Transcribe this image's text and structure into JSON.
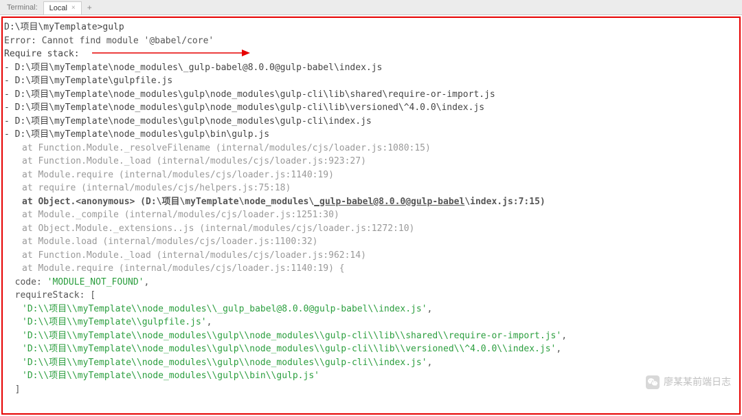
{
  "tabBar": {
    "titleLabel": "Terminal:",
    "tabs": [
      {
        "name": "Local",
        "active": true
      }
    ],
    "addLabel": "+"
  },
  "terminal": {
    "cmdLine": "D:\\项目\\myTemplate>gulp",
    "errorLine": "Error: Cannot find module '@babel/core'",
    "requireLabel": "Require stack:",
    "stackPaths": [
      "- D:\\项目\\myTemplate\\node_modules\\_gulp-babel@8.0.0@gulp-babel\\index.js",
      "- D:\\项目\\myTemplate\\gulpfile.js",
      "- D:\\项目\\myTemplate\\node_modules\\gulp\\node_modules\\gulp-cli\\lib\\shared\\require-or-import.js",
      "- D:\\项目\\myTemplate\\node_modules\\gulp\\node_modules\\gulp-cli\\lib\\versioned\\^4.0.0\\index.js",
      "- D:\\项目\\myTemplate\\node_modules\\gulp\\node_modules\\gulp-cli\\index.js",
      "- D:\\项目\\myTemplate\\node_modules\\gulp\\bin\\gulp.js"
    ],
    "atLines": [
      "at Function.Module._resolveFilename (internal/modules/cjs/loader.js:1080:15)",
      "at Function.Module._load (internal/modules/cjs/loader.js:923:27)",
      "at Module.require (internal/modules/cjs/loader.js:1140:19)",
      "at require (internal/modules/cjs/helpers.js:75:18)"
    ],
    "boldAt": {
      "prefix": "at Object.<anonymous> (D:\\项目\\myTemplate\\node_modules\\",
      "underlined": "_gulp-babel@8.0.0@gulp-babel",
      "suffix": "\\index.js:7:15)"
    },
    "atLines2": [
      "at Module._compile (internal/modules/cjs/loader.js:1251:30)",
      "at Object.Module._extensions..js (internal/modules/cjs/loader.js:1272:10)",
      "at Module.load (internal/modules/cjs/loader.js:1100:32)",
      "at Function.Module._load (internal/modules/cjs/loader.js:962:14)",
      "at Module.require (internal/modules/cjs/loader.js:1140:19) {"
    ],
    "codeLabel": "  code: ",
    "codeValue": "'MODULE_NOT_FOUND'",
    "codeComma": ",",
    "requireStackLabel": "  requireStack: [",
    "requireStackItems": [
      "'D:\\\\项目\\\\myTemplate\\\\node_modules\\\\_gulp_babel@8.0.0@gulp-babel\\\\index.js'",
      "'D:\\\\项目\\\\myTemplate\\\\gulpfile.js'",
      "'D:\\\\项目\\\\myTemplate\\\\node_modules\\\\gulp\\\\node_modules\\\\gulp-cli\\\\lib\\\\shared\\\\require-or-import.js'",
      "'D:\\\\项目\\\\myTemplate\\\\node_modules\\\\gulp\\\\node_modules\\\\gulp-cli\\\\lib\\\\versioned\\\\^4.0.0\\\\index.js'",
      "'D:\\\\项目\\\\myTemplate\\\\node_modules\\\\gulp\\\\node_modules\\\\gulp-cli\\\\index.js'",
      "'D:\\\\项目\\\\myTemplate\\\\node_modules\\\\gulp\\\\bin\\\\gulp.js'"
    ],
    "closeBracket": "  ]"
  },
  "watermark": {
    "text": "廖某某前端日志"
  }
}
